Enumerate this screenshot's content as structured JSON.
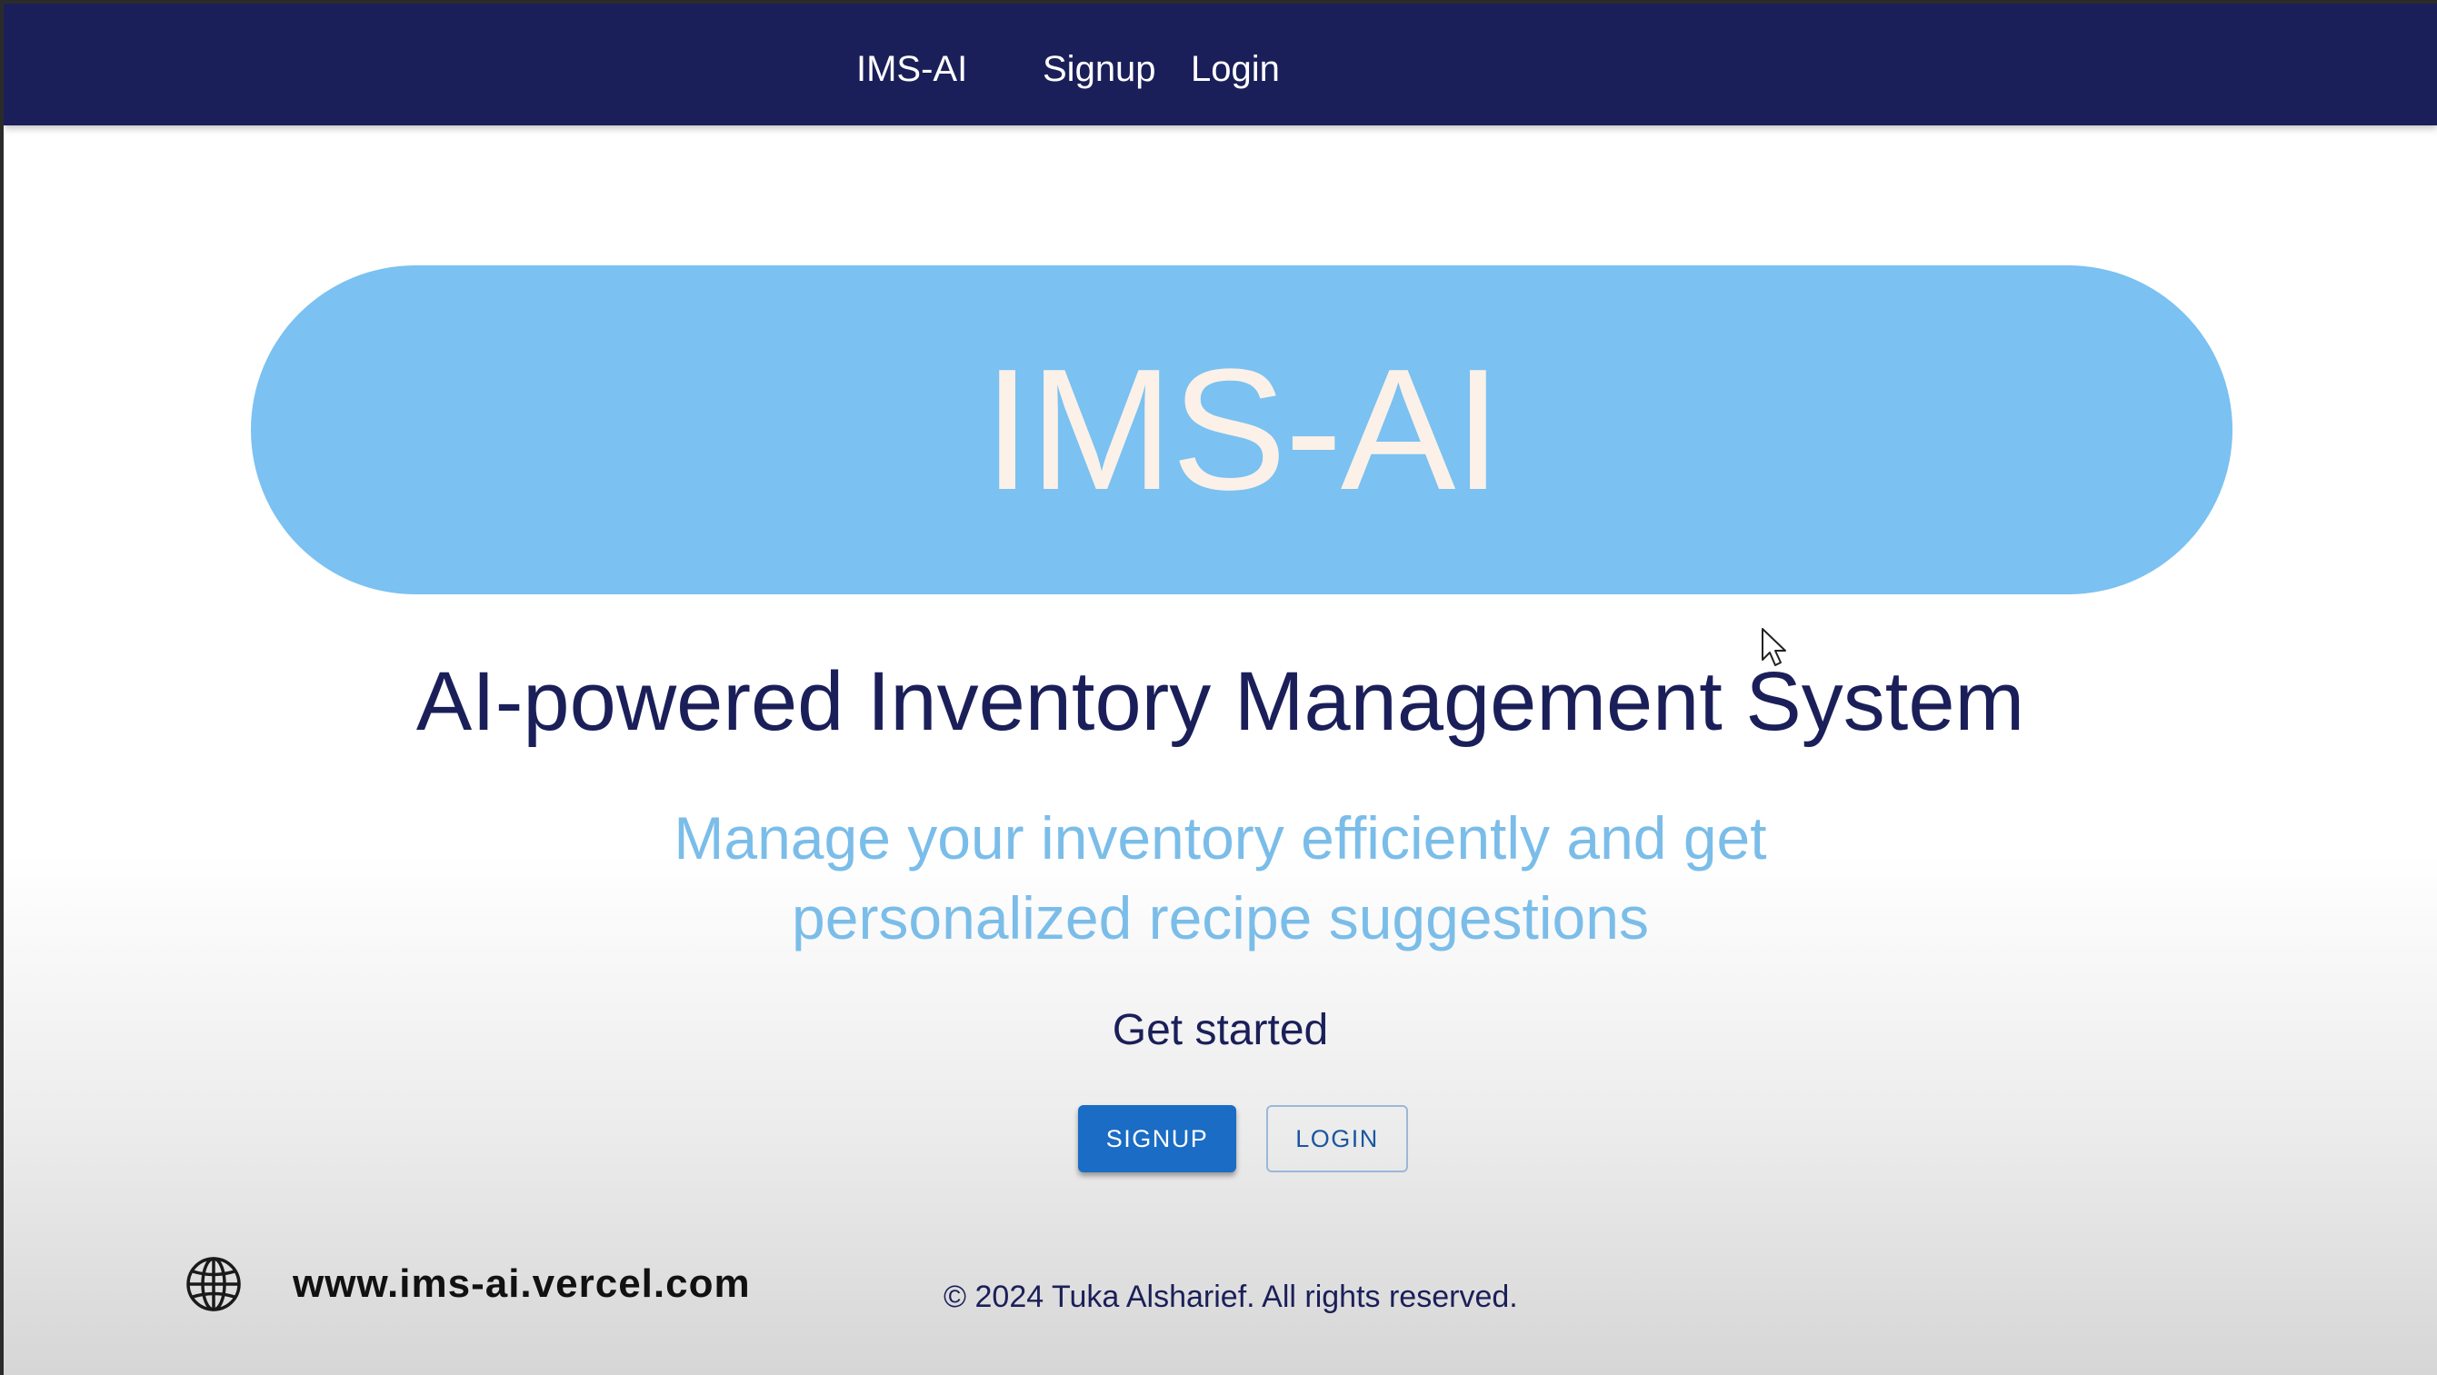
{
  "navbar": {
    "brand": "IMS-AI",
    "signup": "Signup",
    "login": "Login"
  },
  "hero": {
    "title": "IMS-AI",
    "headline": "AI-powered Inventory Management System",
    "subheadline_line1": "Manage your inventory efficiently and get",
    "subheadline_line2": "personalized recipe suggestions",
    "get_started": "Get started"
  },
  "buttons": {
    "signup": "SIGNUP",
    "login": "LOGIN"
  },
  "footer": {
    "icon": "globe-icon",
    "website": "www.ims-ai.vercel.com",
    "copyright": "© 2024 Tuka Alsharief. All rights reserved."
  },
  "colors": {
    "navbar": "#1b1f59",
    "banner": "#7bc1f1",
    "primary_button": "#1a6cc4",
    "subheadline": "#7bbde9"
  }
}
